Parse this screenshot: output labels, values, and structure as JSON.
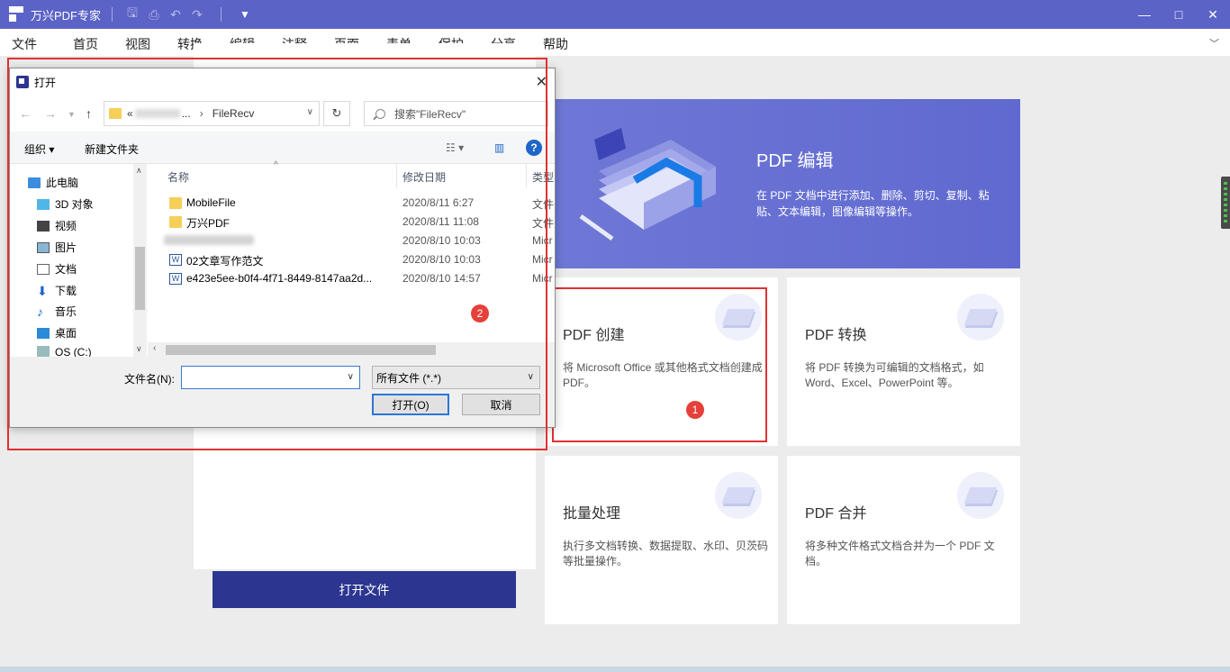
{
  "app": {
    "title": "万兴PDF专家",
    "window_controls": [
      "—",
      "□",
      "✕"
    ]
  },
  "menu": {
    "items": [
      "文件",
      "首页",
      "视图",
      "转换",
      "编辑",
      "注释",
      "页面",
      "表单",
      "保护",
      "分享",
      "帮助"
    ]
  },
  "home": {
    "open_file_label": "打开文件",
    "hero": {
      "title": "PDF 编辑",
      "desc": "在 PDF 文档中进行添加、删除、剪切、复制、粘贴、文本编辑，图像编辑等操作。"
    },
    "cards": [
      {
        "title": "PDF 创建",
        "desc": "将 Microsoft Office 或其他格式文档创建成 PDF。"
      },
      {
        "title": "PDF 转换",
        "desc": "将 PDF 转换为可编辑的文档格式，如 Word、Excel、PowerPoint 等。"
      },
      {
        "title": "批量处理",
        "desc": "执行多文档转换、数据提取、水印、贝茨码等批量操作。"
      },
      {
        "title": "PDF 合并",
        "desc": "将多种文件格式文档合并为一个 PDF 文档。"
      }
    ]
  },
  "badges": {
    "one": "1",
    "two": "2"
  },
  "dialog": {
    "title": "打开",
    "address": {
      "prefix": "«",
      "ellipsis": "...",
      "sep": "›",
      "current": "FileRecv"
    },
    "search_placeholder": "搜索\"FileRecv\"",
    "toolbar": {
      "organize": "组织",
      "new_folder": "新建文件夹"
    },
    "nav_items": [
      "此电脑",
      "3D 对象",
      "视频",
      "图片",
      "文档",
      "下载",
      "音乐",
      "桌面",
      "OS (C:)"
    ],
    "columns": {
      "name": "名称",
      "date": "修改日期",
      "type": "类型"
    },
    "files": [
      {
        "name": "MobileFile",
        "date": "2020/8/11 6:27",
        "type": "文件夹",
        "icon": "folder-icon"
      },
      {
        "name": "万兴PDF",
        "date": "2020/8/11 11:08",
        "type": "文件夹",
        "icon": "folder-icon"
      },
      {
        "name": "",
        "date": "2020/8/10 10:03",
        "type": "Micr",
        "icon": "blurred-file-icon"
      },
      {
        "name": "02文章写作范文",
        "date": "2020/8/10 10:03",
        "type": "Micr",
        "icon": "word-doc-icon"
      },
      {
        "name": "e423e5ee-b0f4-4f71-8449-8147aa2d...",
        "date": "2020/8/10 14:57",
        "type": "Micr",
        "icon": "word-doc-icon"
      }
    ],
    "filename_label": "文件名(N):",
    "filename_value": "",
    "filetype_value": "所有文件 (*.*)",
    "open_button": "打开(O)",
    "cancel_button": "取消"
  },
  "colors": {
    "titlebar": "#5b63c7",
    "primary_button": "#2c3690",
    "highlight": "#e03131"
  }
}
